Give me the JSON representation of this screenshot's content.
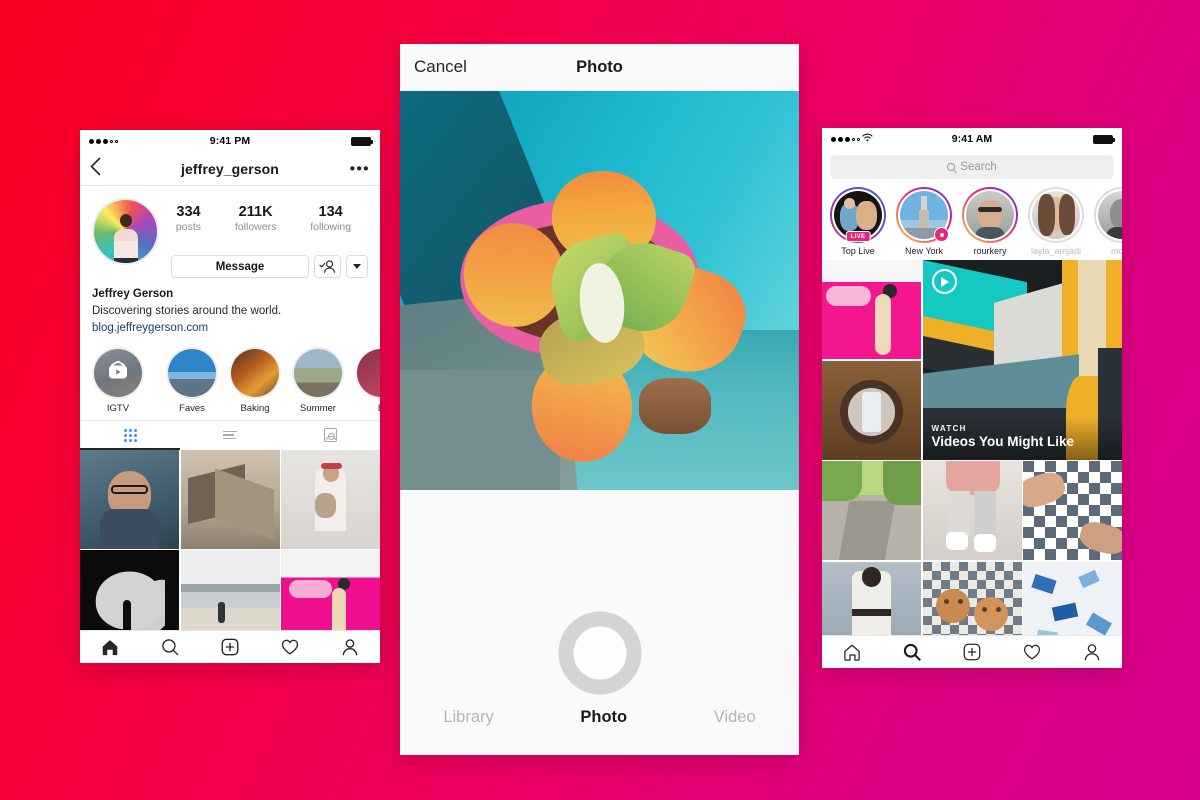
{
  "background": {
    "from": "#fb0020",
    "to": "#d6008f"
  },
  "phone_left": {
    "name": "instagram-profile-screen",
    "status_bar": {
      "time": "9:41 PM",
      "signal_dots": 5,
      "signal_filled": 3
    },
    "nav": {
      "title": "jeffrey_gerson",
      "back_icon": "chevron-left-icon",
      "more_icon": "more-options-icon"
    },
    "stats": [
      {
        "num": "334",
        "label": "posts"
      },
      {
        "num": "211K",
        "label": "followers"
      },
      {
        "num": "134",
        "label": "following"
      }
    ],
    "actions": {
      "message": "Message",
      "follow_icon": "person-check-icon",
      "dropdown_icon": "chevron-down-icon"
    },
    "bio": {
      "name": "Jeffrey Gerson",
      "description": "Discovering stories around the world.",
      "link": "blog.jeffreygerson.com"
    },
    "highlights": [
      {
        "label": "IGTV",
        "icon": "igtv-icon"
      },
      {
        "label": "Faves",
        "icon": ""
      },
      {
        "label": "Baking",
        "icon": ""
      },
      {
        "label": "Summer",
        "icon": ""
      },
      {
        "label": "E",
        "icon": ""
      }
    ],
    "tabs": [
      {
        "name": "grid",
        "icon": "grid-icon",
        "active": true
      },
      {
        "name": "list",
        "icon": "list-icon",
        "active": false
      },
      {
        "name": "tagged",
        "icon": "tagged-photos-icon",
        "active": false
      }
    ],
    "posts": [
      {
        "alt": "man-adjusting-glasses-portrait"
      },
      {
        "alt": "beach-lifeguard-tower-stairs"
      },
      {
        "alt": "woman-with-dog-and-camera"
      },
      {
        "alt": "heart-shaped-light-silhouette"
      },
      {
        "alt": "person-walking-on-beach"
      },
      {
        "alt": "woman-lying-on-pink-couch"
      }
    ],
    "bottom_nav": [
      {
        "name": "home",
        "icon": "home-icon",
        "active": true
      },
      {
        "name": "search",
        "icon": "search-icon",
        "active": false
      },
      {
        "name": "add",
        "icon": "plus-square-icon",
        "active": false
      },
      {
        "name": "activity",
        "icon": "heart-icon",
        "active": false
      },
      {
        "name": "profile",
        "icon": "person-icon",
        "active": false
      }
    ]
  },
  "phone_center": {
    "name": "instagram-camera-screen",
    "header": {
      "cancel": "Cancel",
      "title": "Photo"
    },
    "photo": {
      "alt": "paddle-plant-succulent-on-teal-wall"
    },
    "shutter": {
      "icon": "shutter-button-icon"
    },
    "tabs": [
      {
        "label": "Library",
        "active": false
      },
      {
        "label": "Photo",
        "active": true
      },
      {
        "label": "Video",
        "active": false
      }
    ]
  },
  "phone_right": {
    "name": "instagram-explore-screen",
    "status_bar": {
      "time": "9:41 AM",
      "signal_dots": 5,
      "signal_filled": 3,
      "wifi_icon": "wifi-icon"
    },
    "search": {
      "placeholder": "Search",
      "icon": "search-icon"
    },
    "stories": [
      {
        "label": "Top Live",
        "badge": "LIVE",
        "ring": "live",
        "alt": "two-people-live-broadcast"
      },
      {
        "label": "New York",
        "badge": "location-pin-icon",
        "ring": "gradient",
        "alt": "empire-state-building"
      },
      {
        "label": "rourkery",
        "badge": "",
        "ring": "gradient",
        "alt": "man-with-glasses"
      },
      {
        "label": "layla_amjadi",
        "badge": "",
        "ring": "seen",
        "alt": "woman-portrait"
      },
      {
        "label": "mcan",
        "badge": "",
        "ring": "seen",
        "alt": "man-black-and-white-portrait"
      }
    ],
    "featured": {
      "kicker": "WATCH",
      "title": "Videos You Might Like",
      "play_icon": "play-icon",
      "alt": "colorful-geometric-stairs"
    },
    "tiles": [
      {
        "alt": "woman-on-pink-couch"
      },
      {
        "alt": "phone-in-coconut-bowl"
      },
      {
        "alt": "cobblestone-street-with-trees"
      },
      {
        "alt": "white-sneakers-and-jeans"
      },
      {
        "alt": "hands-on-patterned-tiles"
      },
      {
        "alt": "woman-in-white-dress"
      },
      {
        "alt": "two-smiley-face-cappuccinos"
      },
      {
        "alt": "blue-confetti-pattern"
      }
    ],
    "bottom_nav": [
      {
        "name": "home",
        "icon": "home-icon",
        "active": false
      },
      {
        "name": "search",
        "icon": "search-icon",
        "active": true
      },
      {
        "name": "add",
        "icon": "plus-square-icon",
        "active": false
      },
      {
        "name": "activity",
        "icon": "heart-icon",
        "active": false
      },
      {
        "name": "profile",
        "icon": "person-icon",
        "active": false
      }
    ]
  }
}
